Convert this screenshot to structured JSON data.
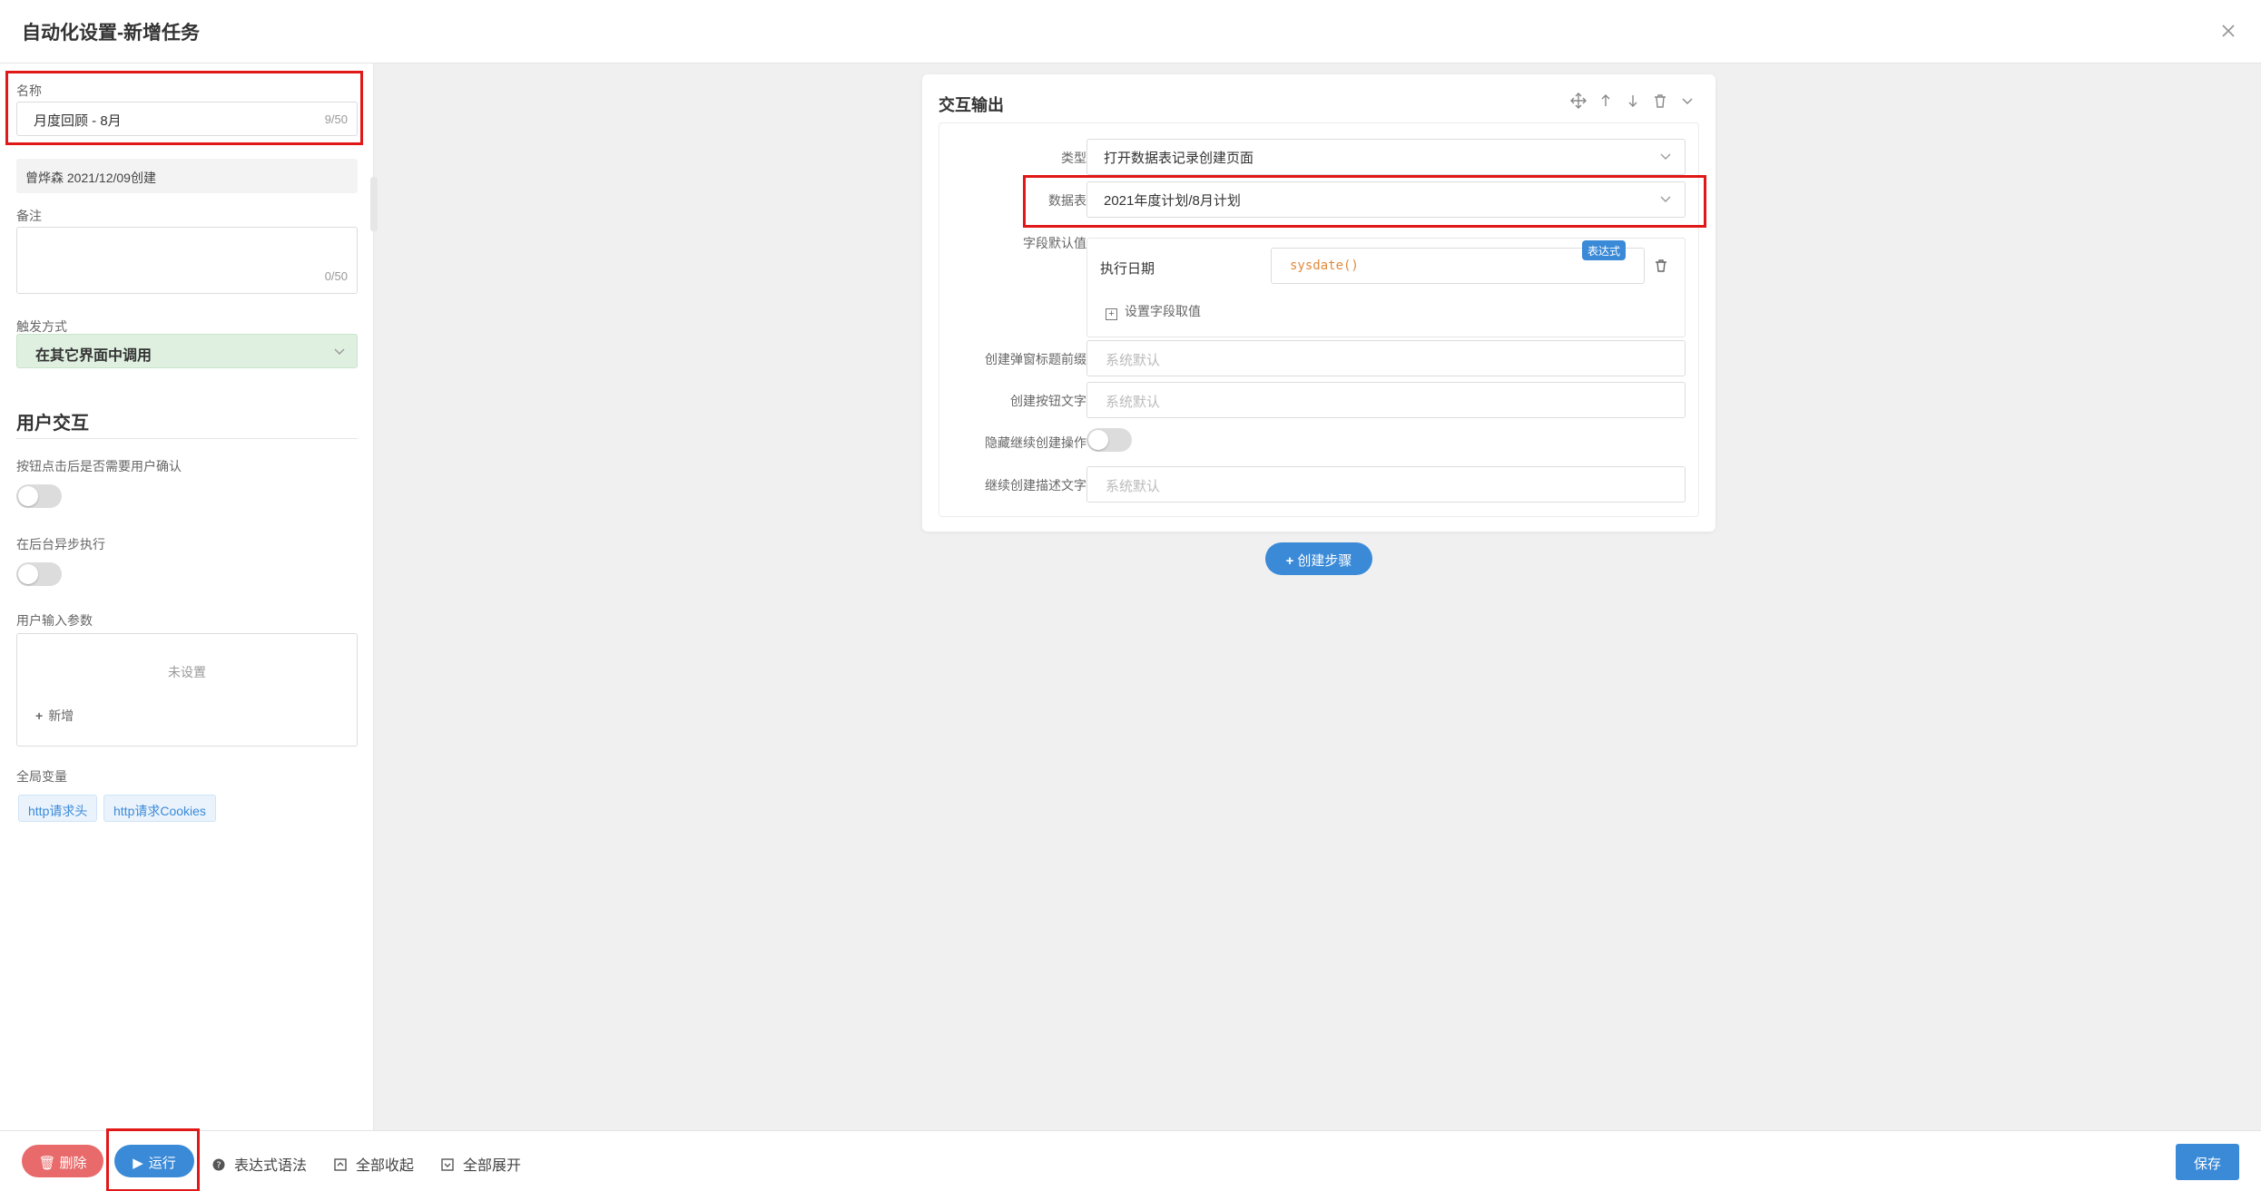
{
  "header": {
    "title": "自动化设置-新增任务"
  },
  "left": {
    "name_label": "名称",
    "name_value": "月度回顾 - 8月",
    "name_counter": "9/50",
    "creator": "曾烨森 2021/12/09创建",
    "remark_label": "备注",
    "remark_counter": "0/50",
    "trigger_label": "触发方式",
    "trigger_value": "在其它界面中调用",
    "section_title": "用户交互",
    "confirm_label": "按钮点击后是否需要用户确认",
    "async_label": "在后台异步执行",
    "params_label": "用户输入参数",
    "params_empty": "未设置",
    "params_add": "新增",
    "globals_label": "全局变量",
    "globals": [
      "http请求头",
      "http请求Cookies"
    ]
  },
  "card": {
    "title": "交互输出",
    "type_label": "类型",
    "type_value": "打开数据表记录创建页面",
    "table_label": "数据表",
    "table_value": "2021年度计划/8月计划",
    "defaults_label": "字段默认值",
    "default_field": "执行日期",
    "default_expr": "sysdate()",
    "expr_badge": "表达式",
    "set_field_value": "设置字段取值",
    "prefix_label": "创建弹窗标题前缀",
    "prefix_placeholder": "系统默认",
    "btn_text_label": "创建按钮文字",
    "btn_text_placeholder": "系统默认",
    "hide_continue_label": "隐藏继续创建操作",
    "continue_desc_label": "继续创建描述文字",
    "continue_desc_placeholder": "系统默认"
  },
  "create_step": "创建步骤",
  "footer": {
    "delete": "删除",
    "run": "运行",
    "expr_syntax": "表达式语法",
    "collapse_all": "全部收起",
    "expand_all": "全部展开",
    "save": "保存"
  },
  "colors": {
    "accent": "#3a8ad8",
    "danger": "#e86a6a",
    "highlight": "#e01818",
    "trigger_bg": "#dff0e0"
  }
}
